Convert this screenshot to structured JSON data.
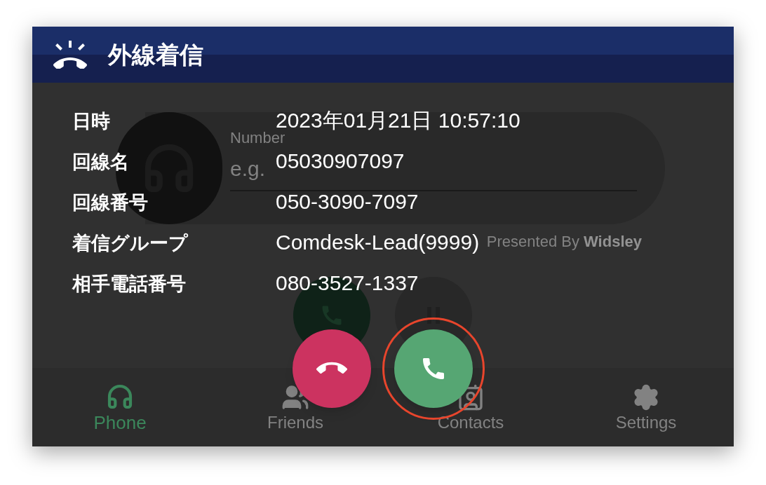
{
  "header": {
    "title": "外線着信"
  },
  "dialer": {
    "number_label": "Number",
    "placeholder": "e.g.",
    "credit": "Presented By **Widsley**"
  },
  "info": [
    {
      "label": "日時",
      "value": "2023年01月21日 10:57:10"
    },
    {
      "label": "回線名",
      "value": "05030907097"
    },
    {
      "label": "回線番号",
      "value": "050-3090-7097"
    },
    {
      "label": "着信グループ",
      "value": "Comdesk-Lead(9999)"
    },
    {
      "label": "相手電話番号",
      "value": "080-3527-1337"
    }
  ],
  "call_buttons": [
    {
      "kind": "decline",
      "highlighted": false
    },
    {
      "kind": "accept",
      "highlighted": true
    }
  ],
  "tabs": [
    {
      "kind": "phone",
      "label": "Phone",
      "selected": true
    },
    {
      "kind": "friends",
      "label": "Friends",
      "selected": false
    },
    {
      "kind": "contacts",
      "label": "Contacts",
      "selected": false
    },
    {
      "kind": "settings",
      "label": "Settings",
      "selected": false
    }
  ]
}
